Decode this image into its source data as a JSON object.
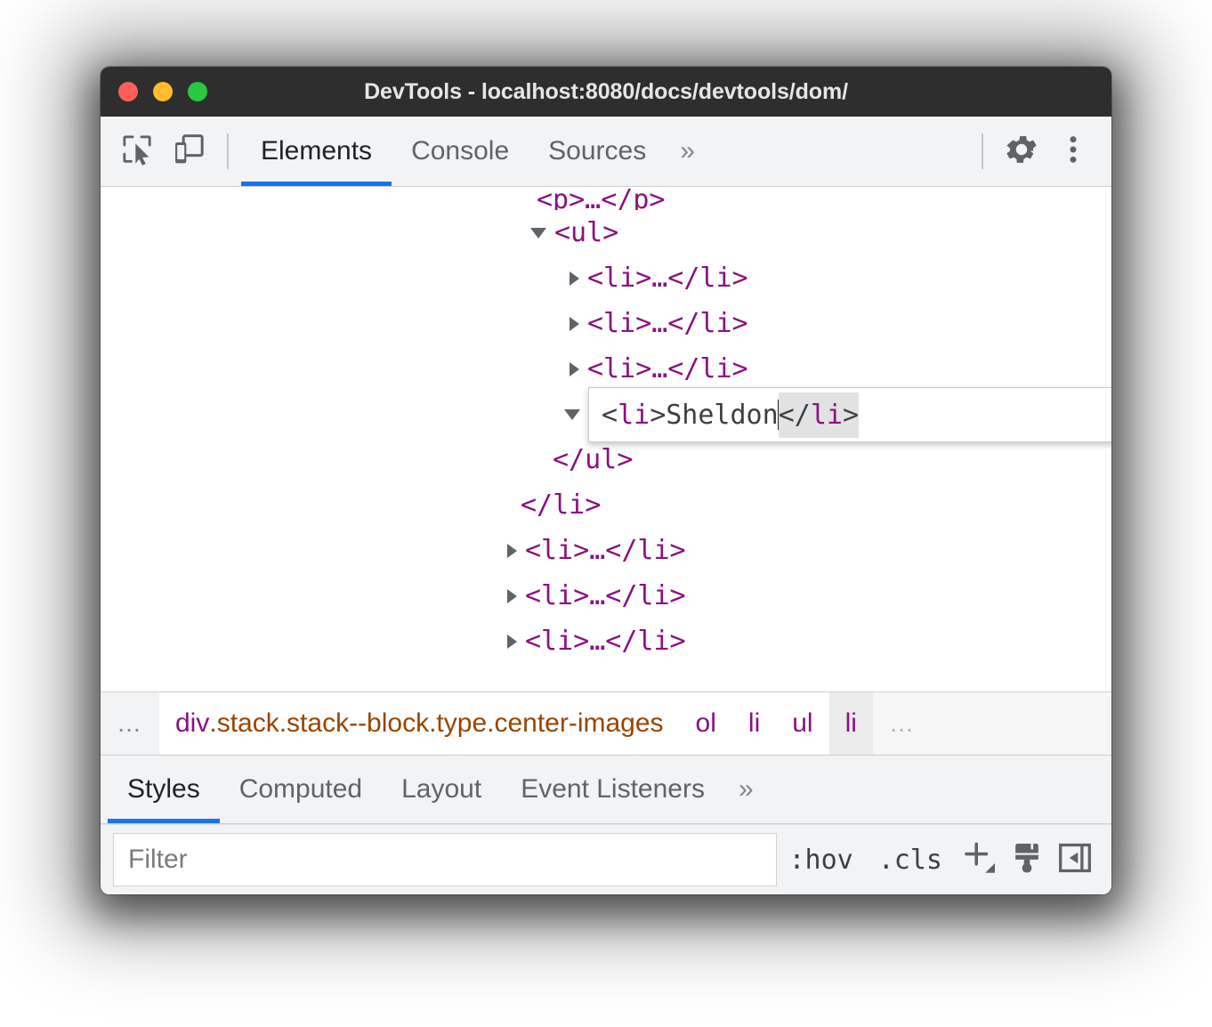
{
  "window": {
    "title": "DevTools - localhost:8080/docs/devtools/dom/",
    "traffic": [
      {
        "name": "close-button",
        "color": "#ff5f57"
      },
      {
        "name": "minimize-button",
        "color": "#febc2e"
      },
      {
        "name": "maximize-button",
        "color": "#28c840"
      }
    ]
  },
  "toolbar": {
    "inspect_icon": "inspect-element-icon",
    "device_icon": "device-toolbar-icon",
    "tabs": [
      {
        "label": "Elements",
        "active": true
      },
      {
        "label": "Console",
        "active": false
      },
      {
        "label": "Sources",
        "active": false
      }
    ],
    "more_tabs": "»",
    "settings_icon": "gear-icon",
    "kebab_icon": "more-options-icon"
  },
  "dom_tree": {
    "rows": [
      {
        "indent": 0,
        "twisty": "none",
        "text": "<p>…</p>",
        "clipped": true
      },
      {
        "indent": 0,
        "twisty": "open",
        "text": "<ul>"
      },
      {
        "indent": 1,
        "twisty": "closed",
        "text": "<li>…</li>"
      },
      {
        "indent": 1,
        "twisty": "closed",
        "text": "<li>…</li>"
      },
      {
        "indent": 1,
        "twisty": "closed",
        "text": "<li>…</li>"
      },
      {
        "indent": 1,
        "twisty": "open",
        "text": "",
        "editing": true
      },
      {
        "indent": 0,
        "twisty": "none",
        "text": "</ul>"
      },
      {
        "indent": -1,
        "twisty": "none",
        "text": "</li>"
      },
      {
        "indent": -1,
        "twisty": "closed",
        "text": "<li>…</li>"
      },
      {
        "indent": -1,
        "twisty": "closed",
        "text": "<li>…</li>"
      },
      {
        "indent": -1,
        "twisty": "closed",
        "text": "<li>…</li>"
      }
    ],
    "edit_box": {
      "open_bracket": "<",
      "open_tag": "li",
      "open_bracket_end": ">",
      "value": "Sheldon",
      "close_bracket": "</",
      "close_tag": "li",
      "close_bracket_end": ">"
    }
  },
  "breadcrumb": {
    "left_ellipsis": "…",
    "items": [
      {
        "tag": "div",
        "classes": ".stack.stack--block.type.center-images",
        "state": "white"
      },
      {
        "tag": "ol",
        "classes": "",
        "state": "white"
      },
      {
        "tag": "li",
        "classes": "",
        "state": "white"
      },
      {
        "tag": "ul",
        "classes": "",
        "state": "white"
      },
      {
        "tag": "li",
        "classes": "",
        "state": "selected"
      }
    ],
    "right_ellipsis": "…",
    "tag_color": "#881280",
    "class_color": "#994500"
  },
  "styles_panel": {
    "tabs": [
      {
        "label": "Styles",
        "active": true
      },
      {
        "label": "Computed",
        "active": false
      },
      {
        "label": "Layout",
        "active": false
      },
      {
        "label": "Event Listeners",
        "active": false
      }
    ],
    "more_tabs": "»",
    "filter": {
      "placeholder": "Filter",
      "value": ""
    },
    "buttons": [
      {
        "label": ":hov",
        "name": "toggle-hover-states-button"
      },
      {
        "label": ".cls",
        "name": "toggle-element-classes-button"
      }
    ],
    "icons": [
      {
        "name": "new-style-rule-icon"
      },
      {
        "name": "paintbrush-icon"
      },
      {
        "name": "toggle-sidebar-icon"
      }
    ]
  },
  "colors": {
    "accent": "#1a73e8",
    "tag": "#881280",
    "class": "#994500",
    "toolbar_bg": "#f1f3f4",
    "titlebar_bg": "#2e2e2e"
  }
}
